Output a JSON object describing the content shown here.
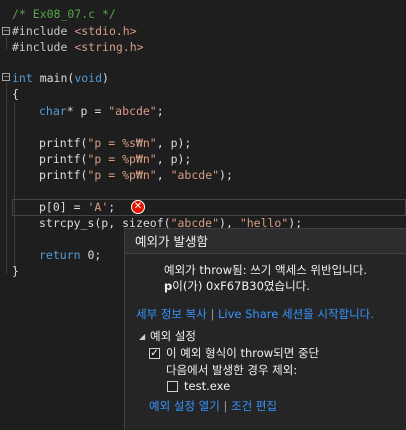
{
  "code": {
    "comment": "/* Ex08_07.c */",
    "include1": {
      "kw": "#include",
      "file": "<stdio.h>"
    },
    "include2": {
      "kw": "#include",
      "file": "<string.h>"
    },
    "main": {
      "kw": "int",
      "name": " main(",
      "param": "void",
      "close": ")"
    },
    "brace_open": "{",
    "decl": {
      "kw": "char",
      "rest": "* p = ",
      "str": "\"abcde\"",
      "end": ";"
    },
    "printf1": {
      "fn": "printf(",
      "str": "\"p = %s₩n\"",
      "end": ", p);"
    },
    "printf2": {
      "fn": "printf(",
      "str": "\"p = %p₩n\"",
      "end": ", p);"
    },
    "printf3": {
      "fn": "printf(",
      "str": "\"p = %p₩n\"",
      "mid": ", ",
      "str2": "\"abcde\"",
      "end": ");"
    },
    "assign": {
      "lhs": "p[0] = ",
      "str": "'A'",
      "end": ";"
    },
    "strcpy": {
      "fn": "strcpy_s(p, si",
      "hidden": "zeof(",
      "str": "\"abcde\"",
      "mid": "), ",
      "str2": "\"hello\"",
      "end": ");"
    },
    "ret": {
      "kw": "return",
      "rest": " 0;"
    },
    "brace_close": "}"
  },
  "exception_popup": {
    "title": "예외가 발생함",
    "message_line1": "예외가 throw됨: 쓰기 액세스 위반입니다.",
    "message_var": "p",
    "message_line2": "이(가) 0xF67B30였습니다.",
    "link_copy_details": "세부 정보 복사",
    "separator": "|",
    "link_live_share": "Live Share 세션을 시작합니다.",
    "settings_header": "예외 설정",
    "checkbox_break_label": "이 예외 형식이 throw되면 중단",
    "checkbox_break_checked": true,
    "except_label": "다음에서 발생한 경우 제외:",
    "checkbox_exe_label": "test.exe",
    "checkbox_exe_checked": false,
    "link_open_settings": "예외 설정 열기",
    "link_edit_conditions": "조건 편집"
  },
  "colors": {
    "editor_bg": "#1e1e1e",
    "keyword": "#569cd6",
    "string": "#d69d85",
    "comment": "#57a64a",
    "link": "#3794ff",
    "error": "#e51400"
  }
}
